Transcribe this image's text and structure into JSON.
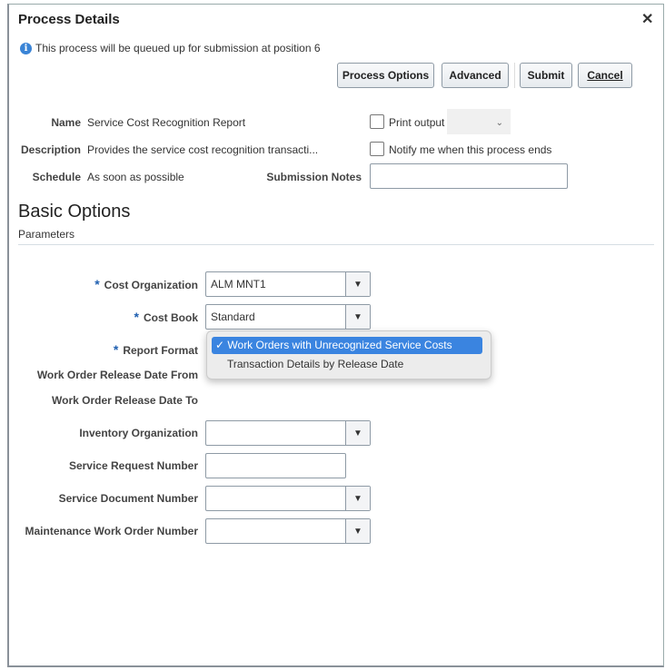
{
  "dialog": {
    "title": "Process Details",
    "close": "✕",
    "info": "This process will be queued up for submission at position 6"
  },
  "buttons": {
    "process_options": "Process Options",
    "advanced": "Advanced",
    "submit": "Submit",
    "cancel": "Cancel"
  },
  "details": {
    "name_label": "Name",
    "name": "Service Cost Recognition Report",
    "description_label": "Description",
    "description": "Provides the service cost recognition transacti...",
    "schedule_label": "Schedule",
    "schedule": "As soon as possible",
    "print_output": "Print output",
    "notify": "Notify me when this process ends",
    "submission_notes": "Submission Notes"
  },
  "section": {
    "title": "Basic Options",
    "subtitle": "Parameters"
  },
  "params": {
    "cost_org_label": "Cost Organization",
    "cost_org": "ALM MNT1",
    "cost_book_label": "Cost Book",
    "cost_book": "Standard",
    "report_format_label": "Report Format",
    "wo_from": "Work Order Release Date From",
    "wo_to": "Work Order Release Date To",
    "inv_org": "Inventory Organization",
    "sr_number": "Service Request Number",
    "sd_number": "Service Document Number",
    "mwo_number": "Maintenance Work Order Number"
  },
  "dropdown": {
    "options": [
      "Work Orders with Unrecognized Service Costs",
      "Transaction Details by Release Date"
    ],
    "check": "✓"
  },
  "colors": {
    "accent": "#3a84e0"
  }
}
